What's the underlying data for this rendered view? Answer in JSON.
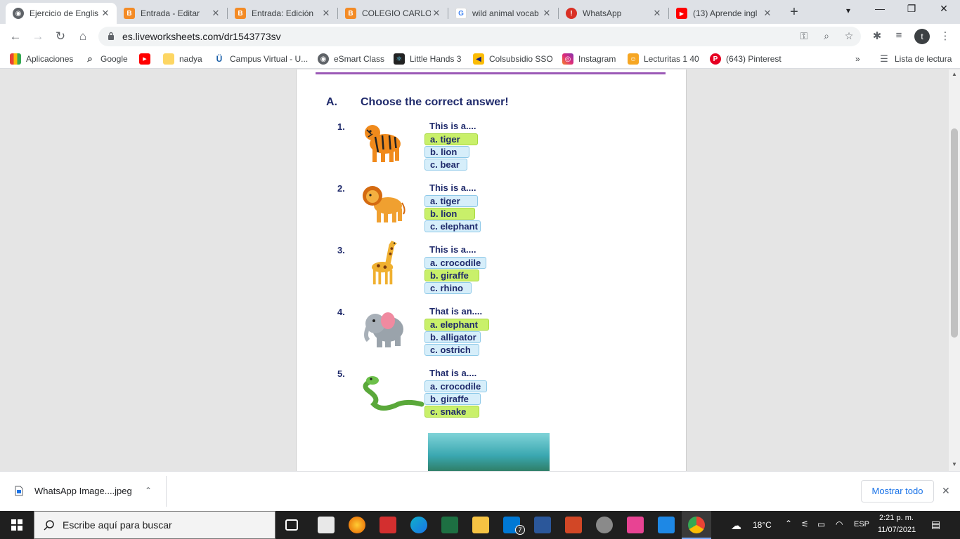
{
  "tabs": [
    {
      "title": "Ejercicio de Englis",
      "active": true,
      "icon": "liveworksheets-icon"
    },
    {
      "title": "Entrada - Editar",
      "icon": "blogger-icon"
    },
    {
      "title": "Entrada: Edición",
      "icon": "blogger-icon"
    },
    {
      "title": "COLEGIO CARLOS",
      "icon": "blogger-icon"
    },
    {
      "title": "wild animal vocab",
      "icon": "google-icon"
    },
    {
      "title": "WhatsApp",
      "icon": "whatsapp-alert-icon"
    },
    {
      "title": "(13) Aprende ingl",
      "icon": "youtube-icon"
    }
  ],
  "tab_close": "✕",
  "new_tab": "+",
  "window": {
    "minimize": "—",
    "maximize": "❐",
    "close": "✕"
  },
  "toolbar": {
    "back": "←",
    "forward": "→",
    "reload": "↻",
    "home": "⌂",
    "url": "es.liveworksheets.com/dr1543773sv",
    "avatar_letter": "t"
  },
  "bookmarks": [
    {
      "label": "Aplicaciones",
      "icon": "apps-grid-icon"
    },
    {
      "label": "Google",
      "icon": "search-icon"
    },
    {
      "label": "",
      "icon": "youtube-icon"
    },
    {
      "label": "nadya",
      "icon": "folder-icon"
    },
    {
      "label": "Campus Virtual - U...",
      "icon": "campus-icon"
    },
    {
      "label": "eSmart Class",
      "icon": "esmart-icon"
    },
    {
      "label": "Little Hands 3",
      "icon": "react-icon"
    },
    {
      "label": "Colsubsidio SSO",
      "icon": "colsubsidio-icon"
    },
    {
      "label": "Instagram",
      "icon": "instagram-icon"
    },
    {
      "label": "Lecturitas 1 40",
      "icon": "lecturitas-icon"
    },
    {
      "label": "(643) Pinterest",
      "icon": "pinterest-icon"
    }
  ],
  "bookmarks_more": "»",
  "reading_list": "Lista de lectura",
  "worksheet": {
    "section": "A.",
    "instruction": "Choose the correct answer!",
    "questions": [
      {
        "number": "1.",
        "prompt": "This is a....",
        "animal": "tiger",
        "options": [
          "a. tiger",
          "b. lion",
          "c. bear"
        ],
        "selected": 0
      },
      {
        "number": "2.",
        "prompt": "This is a....",
        "animal": "lion",
        "options": [
          "a. tiger",
          "b. lion",
          "c. elephant"
        ],
        "selected": 1
      },
      {
        "number": "3.",
        "prompt": "This is a....",
        "animal": "giraffe",
        "options": [
          "a. crocodile",
          "b. giraffe",
          "c. rhino"
        ],
        "selected": 1
      },
      {
        "number": "4.",
        "prompt": "That is an....",
        "animal": "elephant",
        "options": [
          "a. elephant",
          "b. alligator",
          "c. ostrich"
        ],
        "selected": 0
      },
      {
        "number": "5.",
        "prompt": "That is a....",
        "animal": "snake",
        "options": [
          "a. crocodile",
          "b. giraffe",
          "c. snake"
        ],
        "selected": 2
      }
    ]
  },
  "download": {
    "filename": "WhatsApp Image....jpeg",
    "show_all": "Mostrar todo",
    "chevron": "⌃",
    "close": "✕"
  },
  "taskbar": {
    "search_placeholder": "Escribe aquí para buscar",
    "weather": "18°C",
    "language": "ESP",
    "time": "2:21 p. m.",
    "date": "11/07/2021",
    "mail_badge": "7"
  },
  "colors": {
    "selected": "#c9f06a",
    "unselected": "#d6eefa",
    "heading": "#1f2a6b",
    "rule": "#9b59b6"
  }
}
